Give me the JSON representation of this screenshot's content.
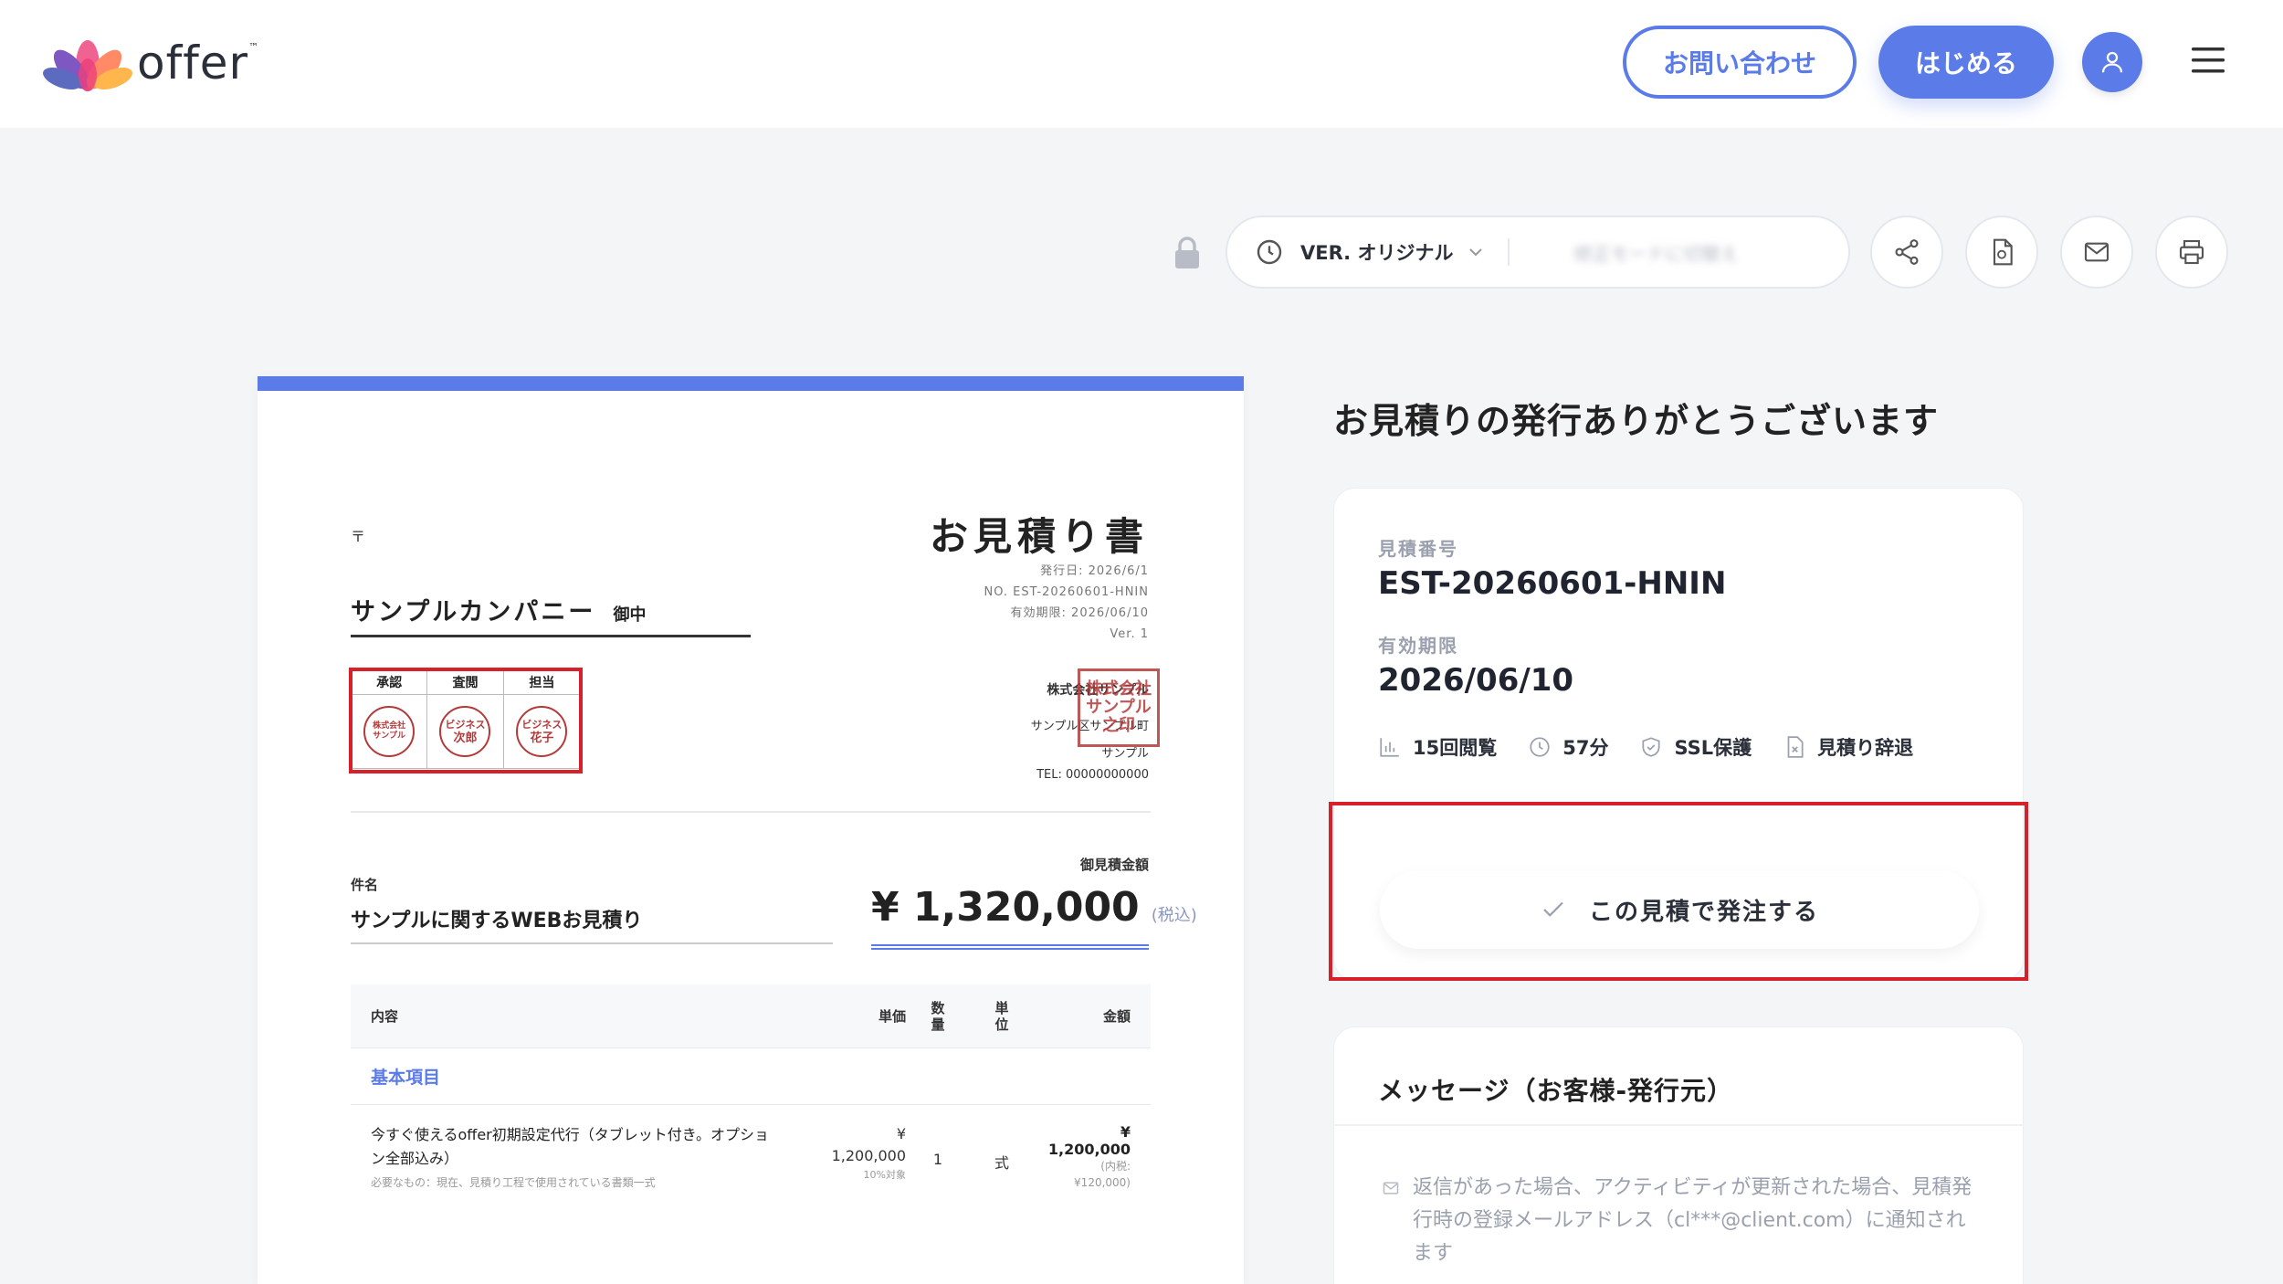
{
  "header": {
    "logo_text": "offer",
    "logo_tm": "™",
    "contact_label": "お問い合わせ",
    "start_label": "はじめる"
  },
  "toolbar": {
    "version_label": "VER. オリジナル",
    "edit_mode_label": "修正モードに切替え"
  },
  "document": {
    "postal_mark": "〒",
    "recipient_name": "サンプルカンパニー",
    "recipient_suffix": "御中",
    "title": "お見積り書",
    "issue_date": "発行日: 2026/6/1",
    "number": "NO. EST-20260601-HNIN",
    "valid_until": "有効期限: 2026/06/10",
    "version": "Ver. 1",
    "stamps": {
      "headers": [
        "承認",
        "査閲",
        "担当"
      ],
      "seal_1": [
        "株式会社",
        "サンプル"
      ],
      "seal_2": [
        "ビジネス",
        "次郎"
      ],
      "seal_3": [
        "ビジネス",
        "花子"
      ]
    },
    "issuer": {
      "name": "株式会社サンプル",
      "address": "サンプル区サンプル町",
      "address2": "サンプル",
      "tel": "TEL: 00000000000",
      "seal_text": "株式会社サンプル之印"
    },
    "subject_label": "件名",
    "subject": "サンプルに関するWEBお見積り",
    "amount_label": "御見積金額",
    "amount": "¥ 1,320,000",
    "amount_tax": "(税込)",
    "table": {
      "headers": {
        "desc": "内容",
        "price": "単価",
        "qty": "数量",
        "unit": "単位",
        "amount": "金額"
      },
      "section": "基本項目",
      "rows": [
        {
          "desc": "今すぐ使えるoffer初期設定代行（タブレット付き。オプション全部込み）",
          "note": "必要なもの：現在、見積り工程で使用されている書類一式",
          "price_symbol": "¥",
          "price": "1,200,000",
          "price_sub": "10%対象",
          "qty": "1",
          "unit": "式",
          "amount": "¥ 1,200,000",
          "amount_sub1": "(内税:",
          "amount_sub2": "¥120,000)"
        }
      ]
    }
  },
  "panel": {
    "thanks": "お見積りの発行ありがとうございます",
    "estimate_label": "見積番号",
    "estimate_number": "EST-20260601-HNIN",
    "valid_label": "有効期限",
    "valid_date": "2026/06/10",
    "stats": {
      "views": "15回閲覧",
      "time": "57分",
      "ssl": "SSL保護",
      "decline": "見積り辞退"
    },
    "order_label": "この見積で発注する",
    "message_title": "メッセージ（お客様-発行元）",
    "message_info": "返信があった場合、アクティビティが更新された場合、見積発行時の登録メールアドレス（cl***@client.com）に通知されます"
  },
  "colors": {
    "accent": "#5b7ce8",
    "highlight": "#d8202a",
    "seal": "#b43a3a"
  },
  "icons": [
    "logo-icon",
    "user-icon",
    "menu-icon",
    "lock-icon",
    "clock-icon",
    "chevron-down-icon",
    "share-icon",
    "pdf-icon",
    "mail-icon",
    "print-icon",
    "chart-icon",
    "shield-icon",
    "file-x-icon",
    "check-icon",
    "mail-small-icon"
  ]
}
